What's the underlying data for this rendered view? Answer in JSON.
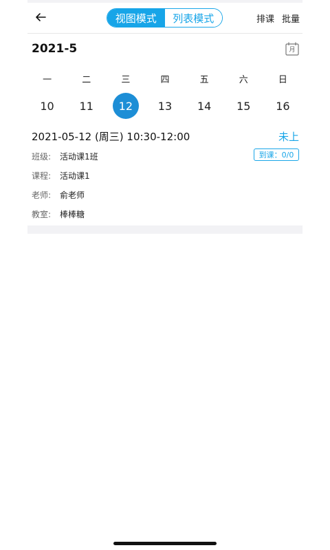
{
  "header": {
    "modes": [
      "视图模式",
      "列表模式"
    ],
    "active_mode": "视图模式",
    "actions": {
      "schedule": "排课",
      "batch": "批量"
    },
    "icons": {
      "back": "arrow-left-icon"
    }
  },
  "calendar": {
    "month_title": "2021-5",
    "month_icon_label": "月",
    "weekdays": [
      "一",
      "二",
      "三",
      "四",
      "五",
      "六",
      "日"
    ],
    "dates": [
      "10",
      "11",
      "12",
      "13",
      "14",
      "15",
      "16"
    ],
    "selected_date": "12"
  },
  "lesson": {
    "time": "2021-05-12 (周三) 10:30-12:00",
    "status": "未上",
    "attendance": "到课：0/0",
    "rows": [
      {
        "label": "班级:",
        "value": "活动课1班"
      },
      {
        "label": "课程:",
        "value": "活动课1"
      },
      {
        "label": "老师:",
        "value": "俞老师"
      },
      {
        "label": "教室:",
        "value": "棒棒糖"
      }
    ]
  },
  "colors": {
    "accent": "#17a5e8",
    "selected_date_bg": "#1d8ed6",
    "divider": "#f2f2f5"
  }
}
